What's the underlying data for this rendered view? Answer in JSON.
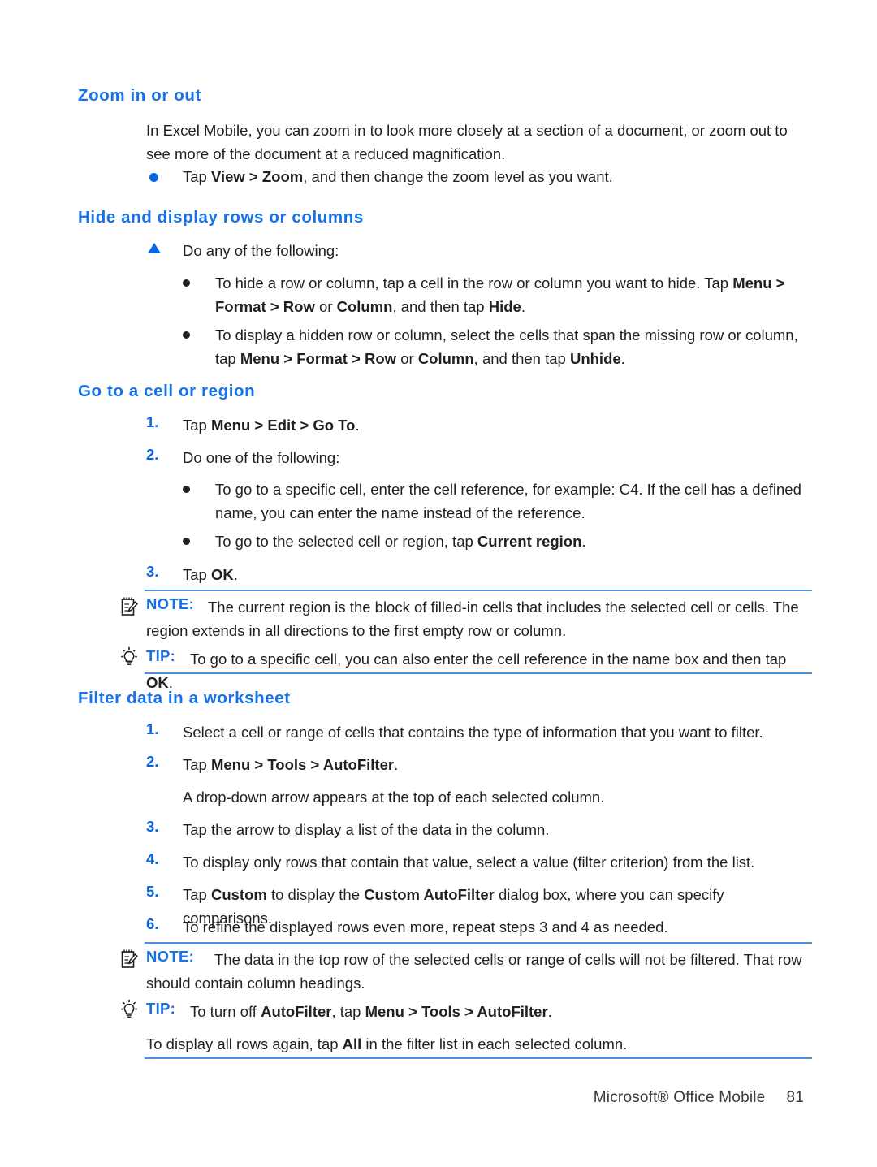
{
  "theme": {
    "heading_color": "#1572e8",
    "accent_blue": "#0a64e6",
    "rule_color": "#4a90e2",
    "body_color": "#231f20"
  },
  "sections": {
    "zoom": {
      "heading": "Zoom in or out",
      "intro": "In Excel Mobile, you can zoom in to look more closely at a section of a document, or zoom out to see more of the document at a reduced magnification.",
      "bullet": {
        "pre": "Tap ",
        "bold": "View > Zoom",
        "post": ", and then change the zoom level as you want."
      }
    },
    "hide": {
      "heading": "Hide and display rows or columns",
      "lead": "Do any of the following:",
      "items": [
        {
          "p1": "To hide a row or column, tap a cell in the row or column you want to hide. Tap ",
          "b1": "Menu > Format > Row",
          "p2": " or ",
          "b2": "Column",
          "p3": ", and then tap ",
          "b3": "Hide",
          "p4": "."
        },
        {
          "p1": "To display a hidden row or column, select the cells that span the missing row or column, tap ",
          "b1": "Menu > Format > Row",
          "p2": " or ",
          "b2": "Column",
          "p3": ", and then tap ",
          "b3": "Unhide",
          "p4": "."
        }
      ]
    },
    "goto": {
      "heading": "Go to a cell or region",
      "steps": [
        {
          "n": "1.",
          "pre": "Tap ",
          "bold": "Menu > Edit > Go To",
          "post": "."
        },
        {
          "n": "2.",
          "pre": "Do one of the following:",
          "bold": "",
          "post": ""
        },
        {
          "n": "3.",
          "pre": "Tap ",
          "bold": "OK",
          "post": "."
        }
      ],
      "subitems": [
        {
          "pre": "To go to a specific cell, enter the cell reference, for example: C4. If the cell has a defined name, you can enter the name instead of the reference.",
          "bold": "",
          "post": ""
        },
        {
          "pre": "To go to the selected cell or region, tap ",
          "bold": "Current region",
          "post": "."
        }
      ],
      "note": {
        "label": "NOTE:",
        "text": "The current region is the block of filled-in cells that includes the selected cell or cells. The region extends in all directions to the first empty row or column.",
        "icon": "note-pad-icon"
      },
      "tip": {
        "label": "TIP:",
        "pre": "To go to a specific cell, you can also enter the cell reference in the name box and then tap ",
        "bold": "OK",
        "post": ".",
        "icon": "lightbulb-icon"
      }
    },
    "filter": {
      "heading": "Filter data in a worksheet",
      "steps": [
        {
          "n": "1.",
          "pre": "Select a cell or range of cells that contains the type of information that you want to filter.",
          "bold": "",
          "post": ""
        },
        {
          "n": "2.",
          "pre": "Tap ",
          "bold": "Menu > Tools > AutoFilter",
          "post": "."
        },
        {
          "n": "3.",
          "pre": "Tap the arrow to display a list of the data in the column.",
          "bold": "",
          "post": ""
        },
        {
          "n": "4.",
          "pre": "To display only rows that contain that value, select a value (filter criterion) from the list.",
          "bold": "",
          "post": ""
        },
        {
          "n": "5.",
          "pre": "Tap ",
          "bold": "Custom",
          "mid": " to display the ",
          "bold2": "Custom AutoFilter",
          "post": " dialog box, where you can specify comparisons."
        },
        {
          "n": "6.",
          "pre": "To refine the displayed rows even more, repeat steps 3 and 4 as needed.",
          "bold": "",
          "post": ""
        }
      ],
      "step2_followup": "A drop-down arrow appears at the top of each selected column.",
      "note": {
        "label": "NOTE:",
        "text": "The data in the top row of the selected cells or range of cells will not be filtered. That row should contain column headings.",
        "icon": "note-pad-icon"
      },
      "tip": {
        "label": "TIP:",
        "pre": "To turn off ",
        "bold": "AutoFilter",
        "mid": ", tap ",
        "bold2": "Menu > Tools > AutoFilter",
        "post": ".",
        "icon": "lightbulb-icon"
      },
      "tip_followup": {
        "pre": "To display all rows again, tap ",
        "bold": "All",
        "post": " in the filter list in each selected column."
      }
    }
  },
  "footer": {
    "product": "Microsoft® Office Mobile",
    "page_number": "81"
  }
}
